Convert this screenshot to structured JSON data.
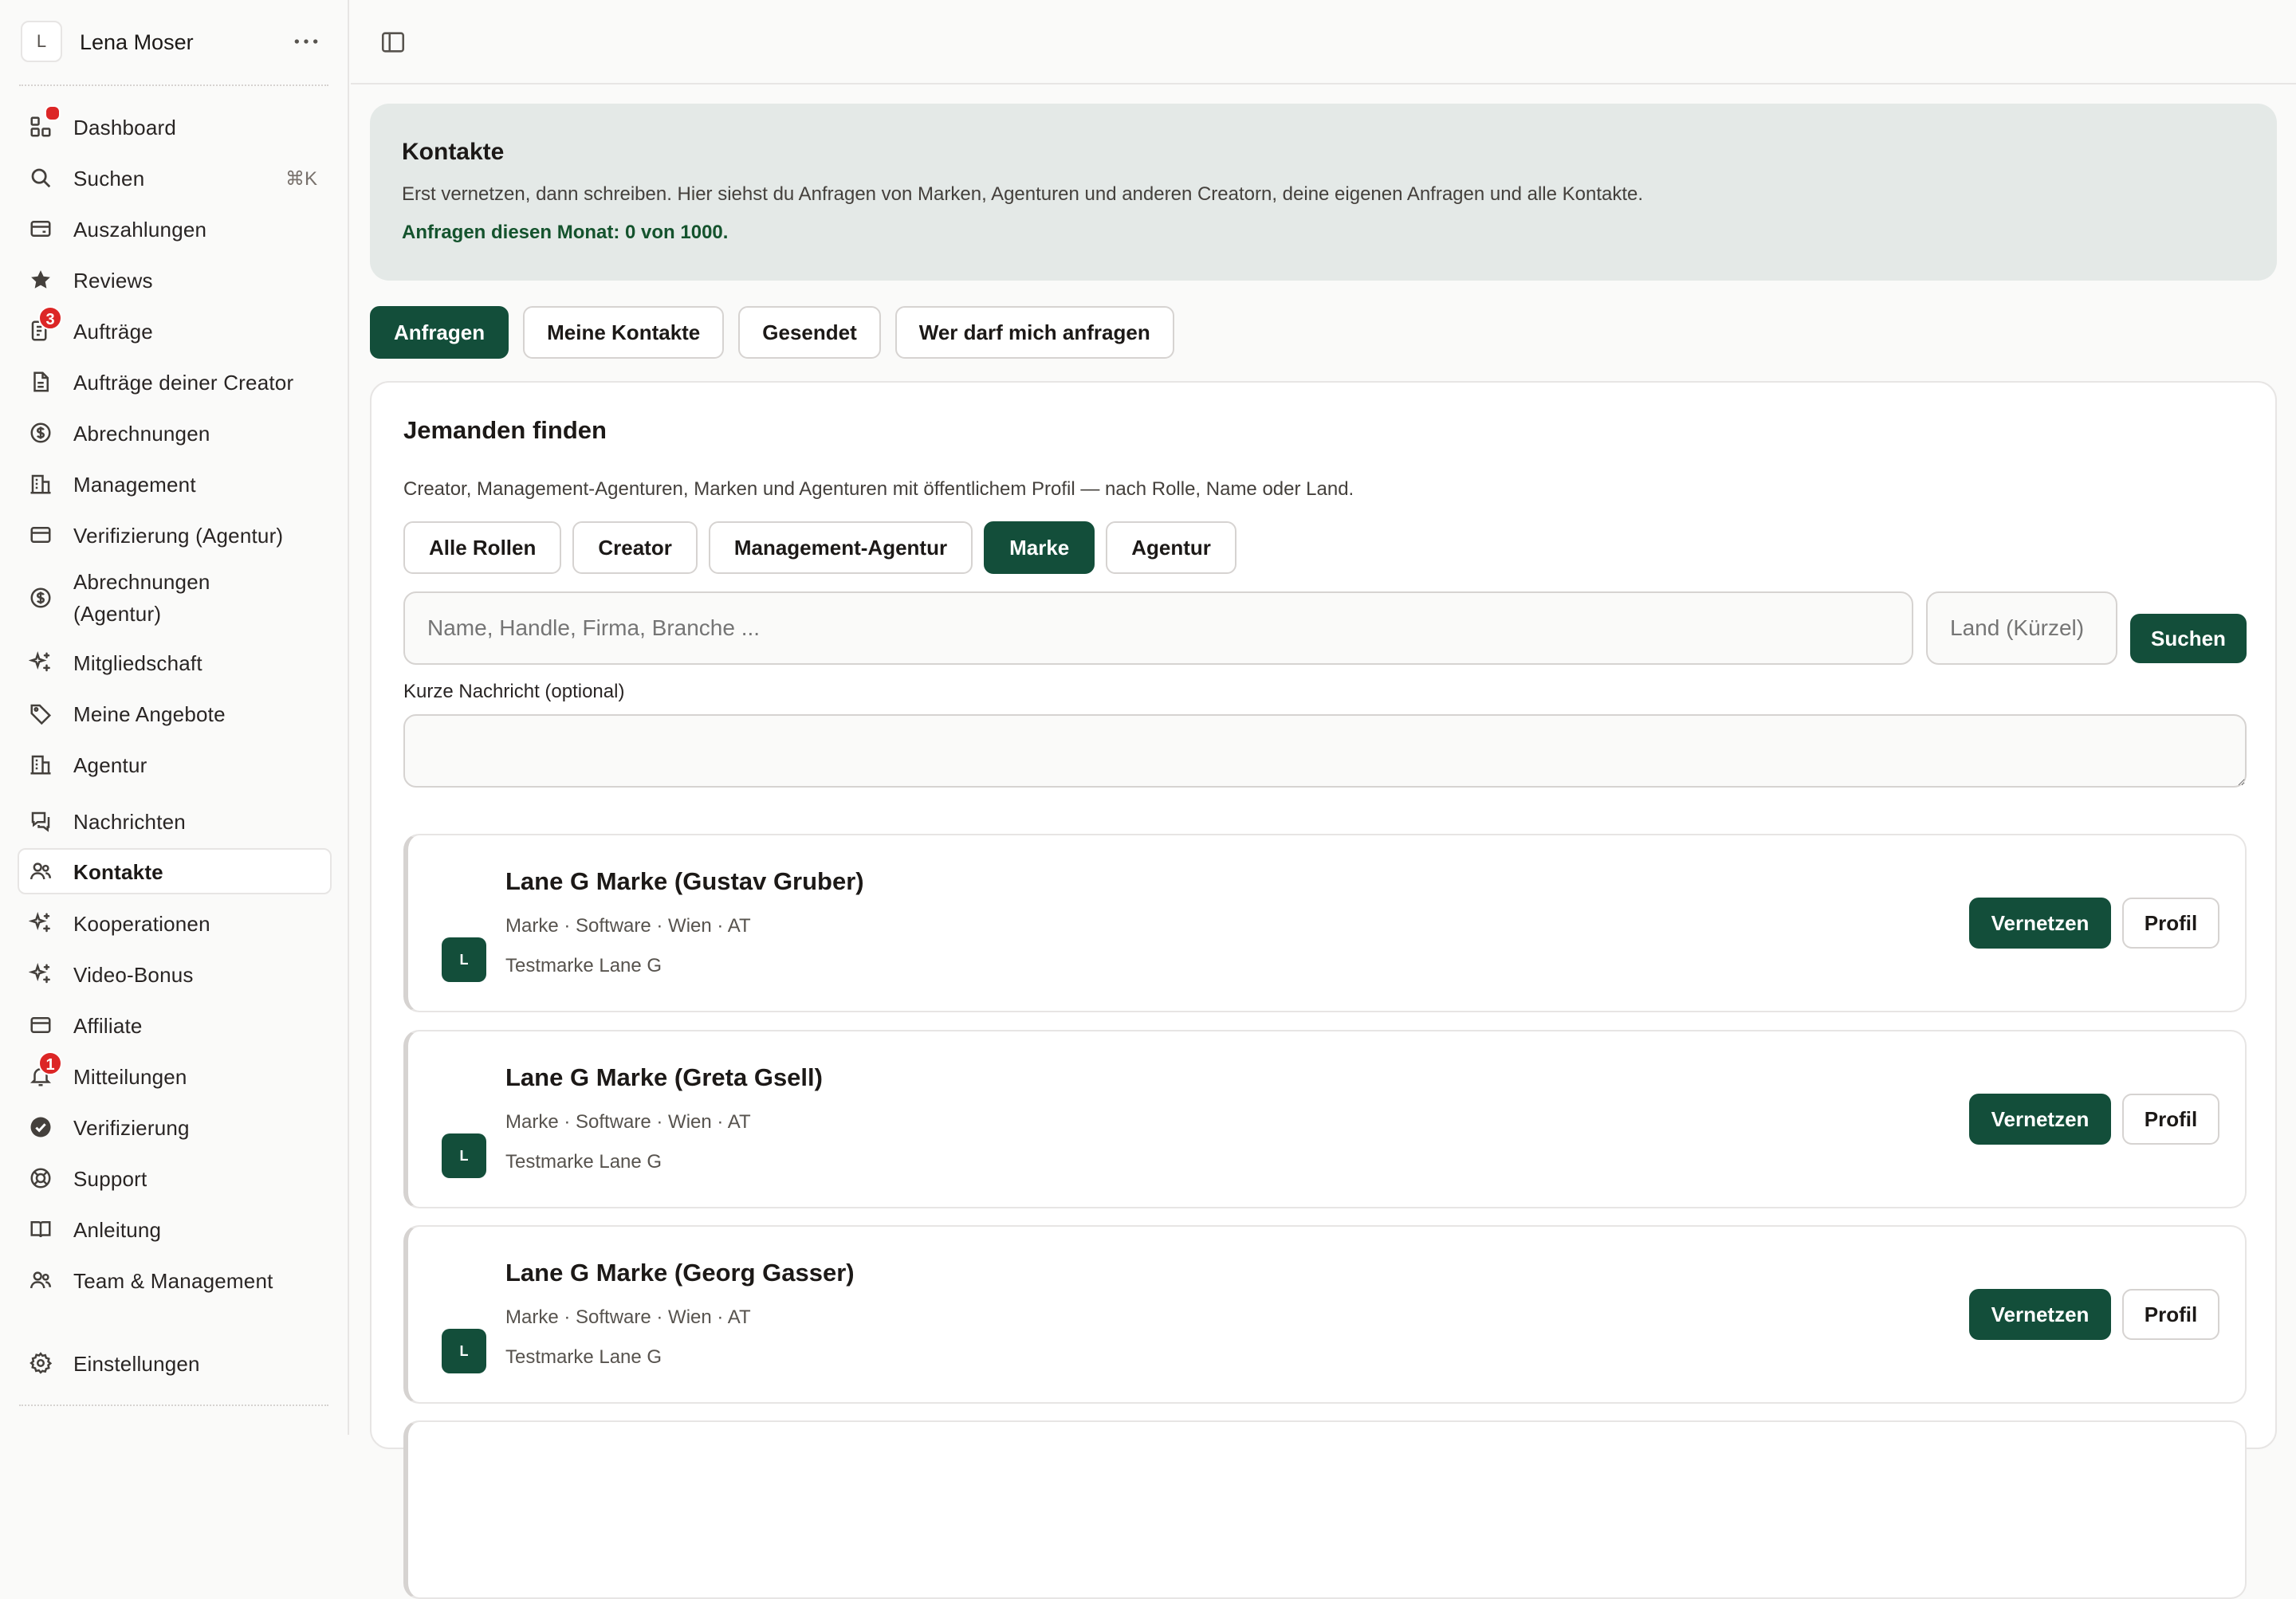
{
  "user": {
    "initial": "L",
    "name": "Lena Moser"
  },
  "sidebar": {
    "items": [
      {
        "label": "Dashboard",
        "icon": "dashboard-icon",
        "dot": true
      },
      {
        "label": "Suchen",
        "icon": "search-icon",
        "shortcut": "⌘K"
      },
      {
        "label": "Auszahlungen",
        "icon": "wallet-icon"
      },
      {
        "label": "Reviews",
        "icon": "star-icon"
      },
      {
        "label": "Aufträge",
        "icon": "orders-icon",
        "badge": "3"
      },
      {
        "label": "Aufträge deiner Creator",
        "icon": "document-icon"
      },
      {
        "label": "Abrechnungen",
        "icon": "dollar-circle-icon"
      },
      {
        "label": "Management",
        "icon": "building-icon"
      },
      {
        "label": "Verifizierung (Agentur)",
        "icon": "card-icon"
      },
      {
        "label": "Abrechnungen (Agentur)",
        "icon": "dollar-circle-icon"
      },
      {
        "label": "Mitgliedschaft",
        "icon": "sparkle-icon"
      },
      {
        "label": "Meine Angebote",
        "icon": "tag-icon"
      },
      {
        "label": "Agentur",
        "icon": "building-icon"
      },
      {
        "label": "Nachrichten",
        "icon": "chat-icon"
      },
      {
        "label": "Kontakte",
        "icon": "users-icon",
        "active": true
      },
      {
        "label": "Kooperationen",
        "icon": "sparkle-icon"
      },
      {
        "label": "Video-Bonus",
        "icon": "sparkle-icon"
      },
      {
        "label": "Affiliate",
        "icon": "card-icon"
      },
      {
        "label": "Mitteilungen",
        "icon": "bell-icon",
        "badge": "1"
      },
      {
        "label": "Verifizierung",
        "icon": "check-circle-icon"
      },
      {
        "label": "Support",
        "icon": "lifebuoy-icon"
      },
      {
        "label": "Anleitung",
        "icon": "book-icon"
      },
      {
        "label": "Team & Management",
        "icon": "users-icon"
      },
      {
        "label": "Einstellungen",
        "icon": "gear-icon"
      }
    ]
  },
  "info": {
    "title": "Kontakte",
    "description": "Erst vernetzen, dann schreiben. Hier siehst du Anfragen von Marken, Agenturen und anderen Creatorn, deine eigenen Anfragen und alle Kontakte.",
    "quota": "Anfragen diesen Monat: 0 von 1000."
  },
  "tabs": [
    {
      "label": "Anfragen",
      "active": true
    },
    {
      "label": "Meine Kontakte"
    },
    {
      "label": "Gesendet"
    },
    {
      "label": "Wer darf mich anfragen"
    }
  ],
  "find": {
    "title": "Jemanden finden",
    "description": "Creator, Management-Agenturen, Marken und Agenturen mit öffentlichem Profil — nach Rolle, Name oder Land.",
    "roles": [
      {
        "label": "Alle Rollen"
      },
      {
        "label": "Creator"
      },
      {
        "label": "Management-Agentur"
      },
      {
        "label": "Marke",
        "active": true
      },
      {
        "label": "Agentur"
      }
    ],
    "search_placeholder": "Name, Handle, Firma, Branche ...",
    "country_placeholder": "Land (Kürzel)",
    "search_button": "Suchen",
    "message_label": "Kurze Nachricht (optional)",
    "message_value": ""
  },
  "results": [
    {
      "initial": "L",
      "name": "Lane G Marke (Gustav Gruber)",
      "meta": "Marke · Software · Wien · AT",
      "subtitle": "Testmarke Lane G",
      "connect": "Vernetzen",
      "profile": "Profil"
    },
    {
      "initial": "L",
      "name": "Lane G Marke (Greta Gsell)",
      "meta": "Marke · Software · Wien · AT",
      "subtitle": "Testmarke Lane G",
      "connect": "Vernetzen",
      "profile": "Profil"
    },
    {
      "initial": "L",
      "name": "Lane G Marke (Georg Gasser)",
      "meta": "Marke · Software · Wien · AT",
      "subtitle": "Testmarke Lane G",
      "connect": "Vernetzen",
      "profile": "Profil"
    }
  ]
}
